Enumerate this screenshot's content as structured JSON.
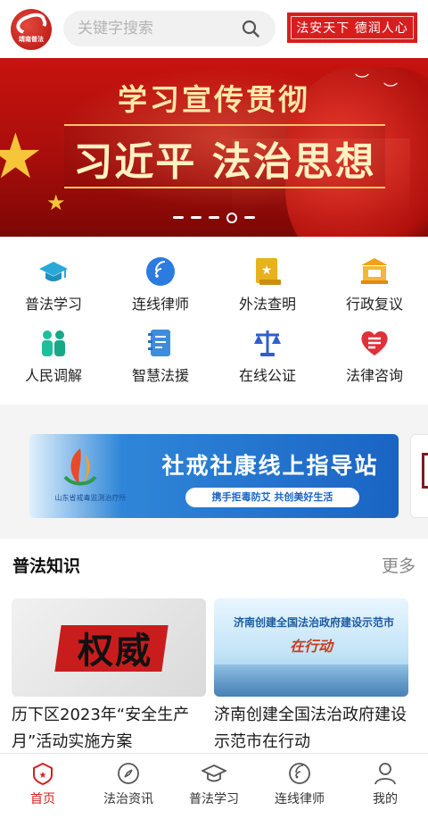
{
  "header": {
    "logo_text": "靖南普法",
    "search_placeholder": "关键字搜索",
    "slogan": "法安天下 德润人心"
  },
  "banner": {
    "title_line1": "学习宣传贯彻",
    "title_line2": "习近平 法治思想",
    "dots_count": 5,
    "active_dot": 4
  },
  "services": [
    {
      "label": "普法学习",
      "icon": "graduation-cap-icon",
      "color": "#2aa9d8"
    },
    {
      "label": "连线律师",
      "icon": "chat-bubble-icon",
      "color": "#2b7be0"
    },
    {
      "label": "外法查明",
      "icon": "law-book-icon",
      "color": "#e8b21c"
    },
    {
      "label": "行政复议",
      "icon": "court-building-icon",
      "color": "#f0a11b"
    },
    {
      "label": "人民调解",
      "icon": "people-icon",
      "color": "#1ebf9a"
    },
    {
      "label": "智慧法援",
      "icon": "notebook-icon",
      "color": "#3e8ddd"
    },
    {
      "label": "在线公证",
      "icon": "scales-icon",
      "color": "#2f5fce"
    },
    {
      "label": "法律咨询",
      "icon": "heart-shield-icon",
      "color": "#e0303a"
    }
  ],
  "ad": {
    "title": "社戒社康线上指导站",
    "subtitle": "携手拒毒防艾 共创美好生活",
    "org": "山东省戒毒监测治疗所"
  },
  "section": {
    "title": "普法知识",
    "more": "更多",
    "cards": [
      {
        "thumb_text": "权威",
        "caption": "历下区2023年“安全生产月”活动实施方案"
      },
      {
        "thumb_head": "济南创建全国法治政府建设示范市",
        "thumb_sub": "在行动",
        "caption": "济南创建全国法治政府建设示范市在行动"
      }
    ]
  },
  "nav": [
    {
      "label": "首页",
      "icon": "home-star-icon",
      "active": true
    },
    {
      "label": "法治资讯",
      "icon": "compass-icon",
      "active": false
    },
    {
      "label": "普法学习",
      "icon": "graduation-cap-icon",
      "active": false
    },
    {
      "label": "连线律师",
      "icon": "chat-bubble-icon",
      "active": false
    },
    {
      "label": "我的",
      "icon": "user-icon",
      "active": false
    }
  ],
  "colors": {
    "brand_red": "#d71e1e",
    "active_tab": "#d71e1e"
  }
}
